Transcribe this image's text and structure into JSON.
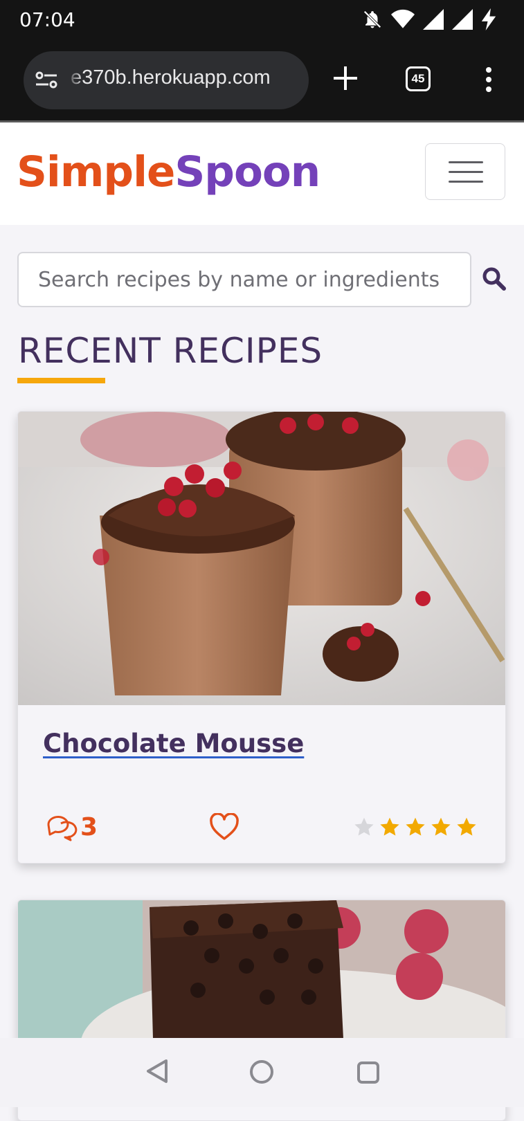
{
  "status_bar": {
    "time": "07:04",
    "icons": [
      "bell-off-icon",
      "wifi-icon",
      "signal-icon",
      "signal-icon",
      "charging-bolt-icon"
    ]
  },
  "browser": {
    "url": "e370b.herokuapp.com",
    "tab_count": "45",
    "icons": [
      "site-settings-icon",
      "new-tab-plus-icon",
      "tab-switcher-icon",
      "overflow-menu-icon"
    ]
  },
  "header": {
    "brand_part1": "Simple",
    "brand_part2": "Spoon",
    "brand_colors": {
      "simple": "#e3501a",
      "spoon": "#7441b9"
    },
    "menu_icon": "hamburger-icon"
  },
  "search": {
    "placeholder": "Search recipes by name or ingredients",
    "value": "",
    "icon": "search-icon"
  },
  "section": {
    "title": "RECENT RECIPES",
    "accent": "#f6a70c"
  },
  "recipes": [
    {
      "title": "Chocolate Mousse",
      "comments": "3",
      "favorite_icon": "heart-outline-icon",
      "rating": 4,
      "max_rating": 5
    },
    {
      "title": "",
      "image": "brownie-photo"
    }
  ],
  "system_nav": {
    "icons": [
      "back-icon",
      "home-icon",
      "recents-icon"
    ]
  }
}
